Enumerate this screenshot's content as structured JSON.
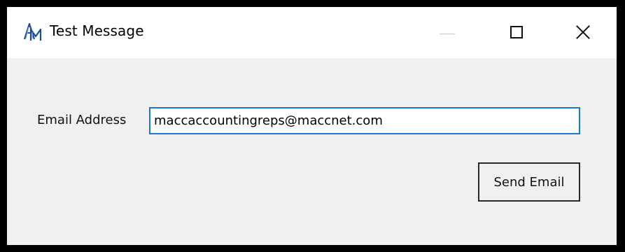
{
  "window": {
    "title": "Test Message",
    "app_icon": "am-logo-icon",
    "controls": {
      "minimize_icon": "minimize-icon",
      "maximize_icon": "maximize-icon",
      "close_icon": "close-icon"
    }
  },
  "form": {
    "email_label": "Email Address",
    "email_value": "maccaccountingreps@maccnet.com",
    "send_label": "Send Email"
  },
  "colors": {
    "focus_border": "#1b78d4",
    "dialog_background": "#f0f0f0",
    "window_frame": "#000000"
  }
}
